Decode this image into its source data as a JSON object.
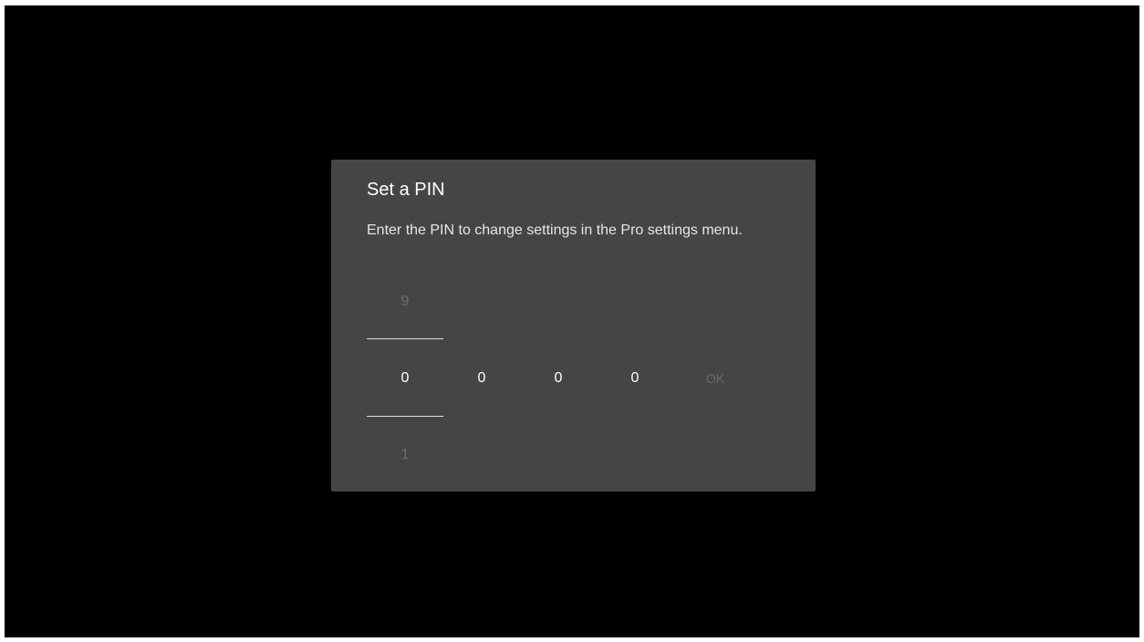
{
  "dialog": {
    "title": "Set a PIN",
    "description": "Enter the PIN to change settings in the Pro settings menu.",
    "active_column": {
      "previous_value": "9",
      "next_value": "1"
    },
    "digits": [
      "0",
      "0",
      "0",
      "0"
    ],
    "ok_label": "OK"
  },
  "colors": {
    "background": "#000000",
    "dialog": "#454545",
    "text": "#ffffff",
    "disabled_text": "#6a6a6a"
  }
}
